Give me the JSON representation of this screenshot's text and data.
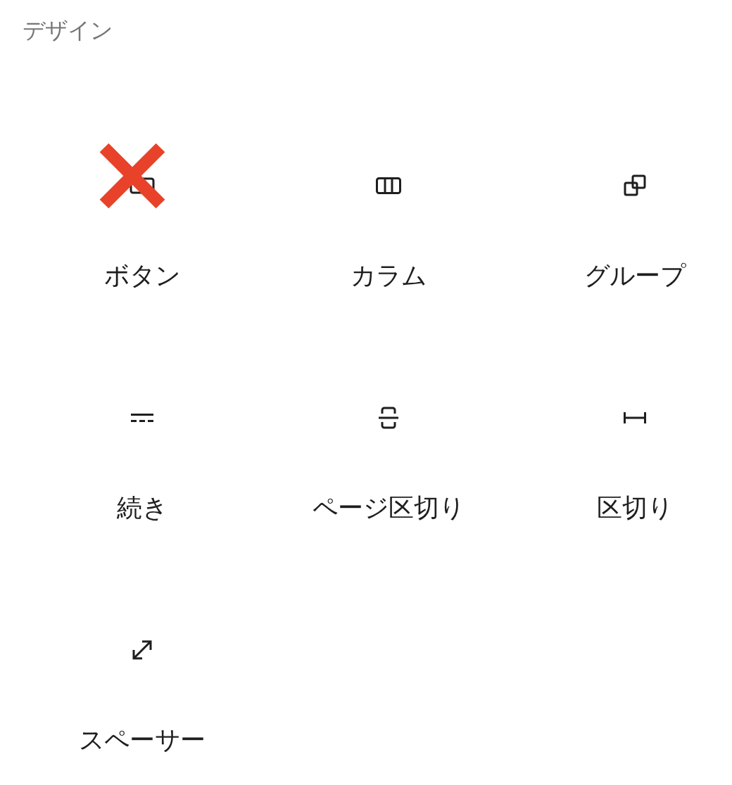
{
  "category": {
    "title": "デザイン"
  },
  "blocks": [
    {
      "label": "ボタン",
      "kind": "button",
      "crossed_out": true
    },
    {
      "label": "カラム",
      "kind": "columns",
      "crossed_out": false
    },
    {
      "label": "グループ",
      "kind": "group",
      "crossed_out": false
    },
    {
      "label": "続き",
      "kind": "more",
      "crossed_out": false
    },
    {
      "label": "ページ区切り",
      "kind": "page-break",
      "crossed_out": false
    },
    {
      "label": "区切り",
      "kind": "separator",
      "crossed_out": false
    },
    {
      "label": "スペーサー",
      "kind": "spacer",
      "crossed_out": false
    }
  ]
}
